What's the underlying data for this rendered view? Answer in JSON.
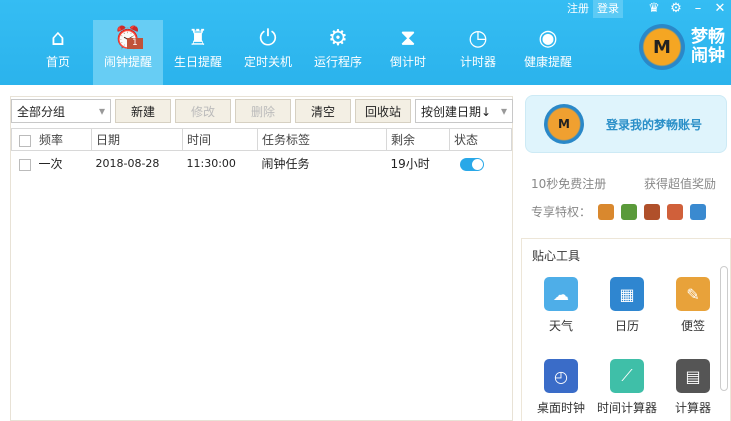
{
  "topbar": {
    "register": "注册",
    "login": "登录"
  },
  "nav": [
    {
      "label": "首页",
      "icon": "⌂"
    },
    {
      "label": "闹钟提醒",
      "icon": "⏰"
    },
    {
      "label": "生日提醒",
      "icon": "♜"
    },
    {
      "label": "定时关机",
      "icon": "⏻"
    },
    {
      "label": "运行程序",
      "icon": "⚙"
    },
    {
      "label": "倒计时",
      "icon": "⧗"
    },
    {
      "label": "计时器",
      "icon": "◷"
    },
    {
      "label": "健康提醒",
      "icon": "◉"
    }
  ],
  "badge": "1",
  "logo": {
    "text": "梦畅闹钟",
    "mark": "M"
  },
  "toolbar": {
    "group": "全部分组",
    "new": "新建",
    "edit": "修改",
    "delete": "删除",
    "clear": "清空",
    "recycle": "回收站",
    "sort": "按创建日期↓"
  },
  "table": {
    "headers": [
      "频率",
      "日期",
      "时间",
      "任务标签",
      "剩余",
      "状态"
    ],
    "rows": [
      {
        "freq": "一次",
        "date": "2018-08-28",
        "time": "11:30:00",
        "label": "闹钟任务",
        "remain": "19小时",
        "enabled": true
      }
    ]
  },
  "account": {
    "login": "登录我的梦畅账号",
    "register": "10秒免费注册",
    "reward": "获得超值奖励",
    "privilege": "专享特权："
  },
  "tools": {
    "title": "贴心工具",
    "items": [
      {
        "label": "天气",
        "icon": "☁",
        "color": "#4eaee8"
      },
      {
        "label": "日历",
        "icon": "▦",
        "color": "#2f86d0"
      },
      {
        "label": "便签",
        "icon": "✎",
        "color": "#e8a23a"
      },
      {
        "label": "桌面时钟",
        "icon": "◴",
        "color": "#3a6cc8"
      },
      {
        "label": "时间计算器",
        "icon": "⟋",
        "color": "#3fbfa8"
      },
      {
        "label": "计算器",
        "icon": "▤",
        "color": "#555"
      }
    ]
  }
}
